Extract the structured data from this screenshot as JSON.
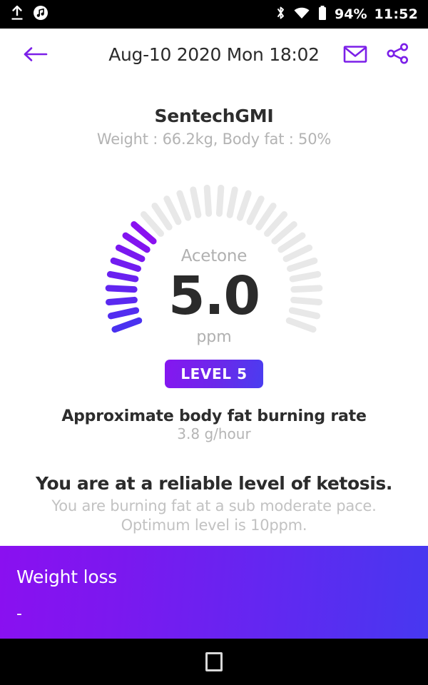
{
  "statusbar": {
    "icons_left": [
      "upload-icon",
      "music-note-icon"
    ],
    "icons_right": [
      "bluetooth-icon",
      "wifi-icon",
      "battery-icon"
    ],
    "battery": "94%",
    "time": "11:52"
  },
  "appbar": {
    "back_icon": "back-arrow-icon",
    "title": "Aug-10 2020 Mon 18:02",
    "mail_icon": "envelope-icon",
    "share_icon": "share-icon"
  },
  "device": {
    "name": "SentechGMI",
    "stats": "Weight : 66.2kg, Body fat : 50%"
  },
  "gauge": {
    "label": "Acetone",
    "value": "5.0",
    "unit": "ppm",
    "level_badge": "LEVEL 5",
    "total_ticks": 30,
    "filled_ticks": 9,
    "fill_color_start": "#8a10f0",
    "fill_color_end": "#4738f0",
    "empty_color": "#e8e8e8"
  },
  "burn_rate": {
    "title": "Approximate body fat burning rate",
    "value": "3.8 g/hour"
  },
  "message": {
    "title": "You are at a reliable level of ketosis.",
    "line1": "You are burning fat at a sub moderate pace.",
    "line2": "Optimum level is 10ppm."
  },
  "weight_loss": {
    "title": "Weight loss",
    "value": "-"
  },
  "navbar": {
    "recents_icon": "square-recents-icon"
  },
  "colors": {
    "accent_purple": "#7B1FE8",
    "accent_blue": "#4738F0",
    "text_dark": "#2b2b2b",
    "text_muted": "#b5b5b5"
  }
}
